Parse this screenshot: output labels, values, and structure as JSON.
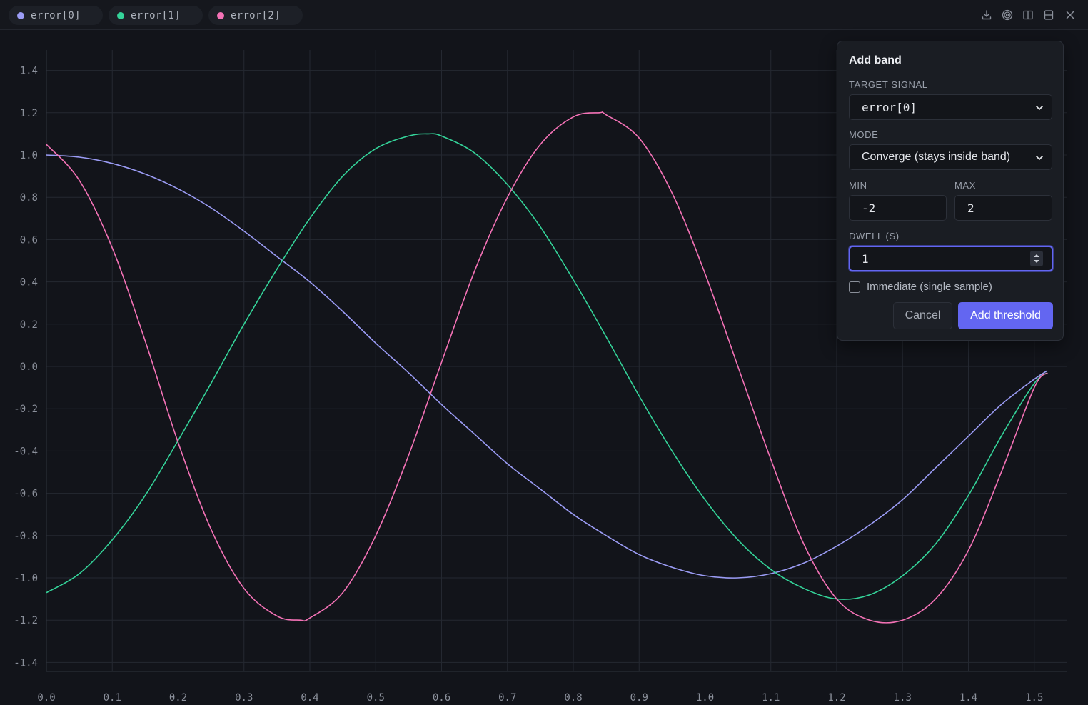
{
  "legend": {
    "chips": [
      {
        "label": "error[0]",
        "color": "#9b9cf5"
      },
      {
        "label": "error[1]",
        "color": "#34d399"
      },
      {
        "label": "error[2]",
        "color": "#f472b6"
      }
    ]
  },
  "toolbar": {
    "icons": [
      "download-icon",
      "target-icon",
      "split-vertical-icon",
      "split-horizontal-icon",
      "close-icon"
    ]
  },
  "chart_data": {
    "type": "line",
    "title": "",
    "xlabel": "",
    "ylabel": "",
    "xlim": [
      0.0,
      1.55
    ],
    "ylim": [
      -1.45,
      1.45
    ],
    "grid": true,
    "x_ticks": [
      "0.0",
      "0.1",
      "0.2",
      "0.3",
      "0.4",
      "0.5",
      "0.6",
      "0.7",
      "0.8",
      "0.9",
      "1.0",
      "1.1",
      "1.2",
      "1.3",
      "1.4",
      "1.5"
    ],
    "y_ticks": [
      "1.4",
      "1.2",
      "1.0",
      "0.8",
      "0.6",
      "0.4",
      "0.2",
      "0.0",
      "-0.2",
      "-0.4",
      "-0.6",
      "-0.8",
      "-1.0",
      "-1.2",
      "-1.4"
    ],
    "series": [
      {
        "name": "error[0]",
        "color": "#9b9cf5",
        "x": [
          0.0,
          0.05,
          0.1,
          0.15,
          0.2,
          0.25,
          0.3,
          0.35,
          0.4,
          0.45,
          0.5,
          0.55,
          0.6,
          0.65,
          0.7,
          0.75,
          0.8,
          0.85,
          0.9,
          0.95,
          1.0,
          1.05,
          1.1,
          1.15,
          1.2,
          1.25,
          1.3,
          1.35,
          1.4,
          1.45,
          1.5,
          1.52
        ],
        "values": [
          1.0,
          0.99,
          0.96,
          0.91,
          0.84,
          0.75,
          0.64,
          0.52,
          0.4,
          0.26,
          0.11,
          -0.03,
          -0.18,
          -0.32,
          -0.46,
          -0.58,
          -0.7,
          -0.8,
          -0.89,
          -0.95,
          -0.99,
          -1.0,
          -0.98,
          -0.93,
          -0.85,
          -0.75,
          -0.63,
          -0.48,
          -0.33,
          -0.18,
          -0.06,
          -0.02
        ]
      },
      {
        "name": "error[1]",
        "color": "#34d399",
        "x": [
          0.0,
          0.05,
          0.1,
          0.15,
          0.2,
          0.25,
          0.3,
          0.35,
          0.4,
          0.45,
          0.5,
          0.55,
          0.58,
          0.6,
          0.65,
          0.7,
          0.75,
          0.8,
          0.85,
          0.9,
          0.95,
          1.0,
          1.05,
          1.1,
          1.15,
          1.2,
          1.25,
          1.3,
          1.35,
          1.4,
          1.45,
          1.5,
          1.52
        ],
        "values": [
          -1.07,
          -0.98,
          -0.82,
          -0.61,
          -0.35,
          -0.08,
          0.2,
          0.46,
          0.7,
          0.9,
          1.03,
          1.09,
          1.1,
          1.09,
          1.01,
          0.86,
          0.66,
          0.41,
          0.14,
          -0.14,
          -0.4,
          -0.63,
          -0.82,
          -0.96,
          -1.05,
          -1.1,
          -1.08,
          -0.99,
          -0.84,
          -0.61,
          -0.33,
          -0.08,
          -0.03
        ]
      },
      {
        "name": "error[2]",
        "color": "#f472b6",
        "x": [
          0.0,
          0.05,
          0.1,
          0.15,
          0.2,
          0.25,
          0.3,
          0.35,
          0.385,
          0.4,
          0.45,
          0.5,
          0.55,
          0.6,
          0.65,
          0.7,
          0.75,
          0.8,
          0.84,
          0.85,
          0.9,
          0.95,
          1.0,
          1.05,
          1.1,
          1.15,
          1.2,
          1.25,
          1.3,
          1.35,
          1.4,
          1.45,
          1.5,
          1.52
        ],
        "values": [
          1.05,
          0.88,
          0.56,
          0.12,
          -0.36,
          -0.77,
          -1.05,
          -1.18,
          -1.2,
          -1.19,
          -1.07,
          -0.8,
          -0.42,
          0.02,
          0.45,
          0.8,
          1.05,
          1.18,
          1.2,
          1.19,
          1.08,
          0.82,
          0.44,
          0.0,
          -0.44,
          -0.84,
          -1.1,
          -1.2,
          -1.2,
          -1.1,
          -0.87,
          -0.5,
          -0.1,
          -0.03
        ]
      }
    ]
  },
  "panel": {
    "title": "Add band",
    "target_signal_label": "Target signal",
    "target_signal_value": "error[0]",
    "mode_label": "Mode",
    "mode_value": "Converge (stays inside band)",
    "min_label": "Min",
    "min_value": "-2",
    "max_label": "Max",
    "max_value": "2",
    "dwell_label": "Dwell (s)",
    "dwell_value": "1",
    "immediate_label": "Immediate (single sample)",
    "immediate_checked": false,
    "cancel_label": "Cancel",
    "submit_label": "Add threshold"
  }
}
